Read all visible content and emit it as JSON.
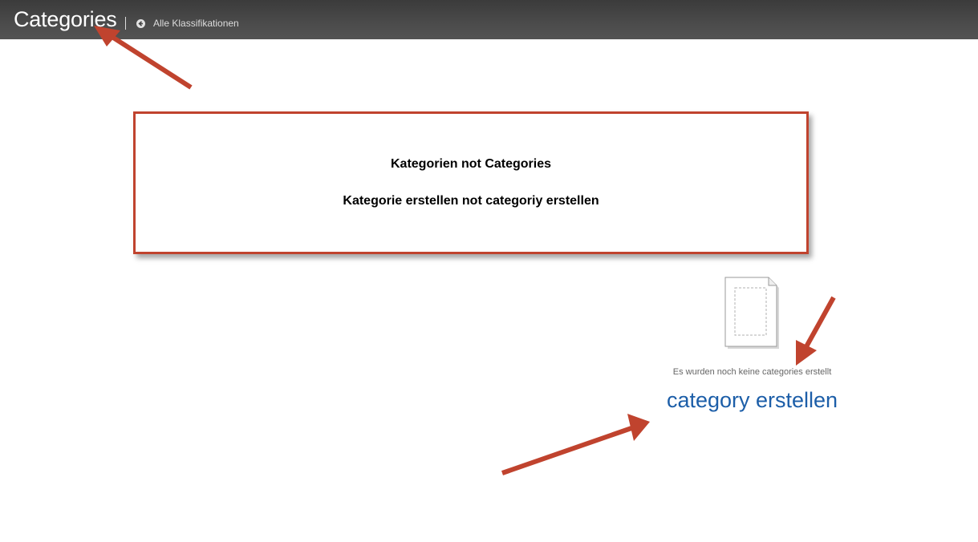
{
  "header": {
    "title": "Categories",
    "back_link_label": "Alle Klassifikationen",
    "back_icon": "arrow-left-circle-icon"
  },
  "annotation": {
    "line1": "Kategorien not Categories",
    "line2": "Kategorie erstellen not categoriy erstellen",
    "border_color": "#c0432e"
  },
  "empty_state": {
    "icon": "blank-document-icon",
    "message": "Es wurden noch keine categories erstellt",
    "create_label": "category erstellen",
    "link_color": "#1c5ea8"
  },
  "arrows": {
    "icon": "arrow-annotation-icon",
    "color": "#c0432e"
  }
}
